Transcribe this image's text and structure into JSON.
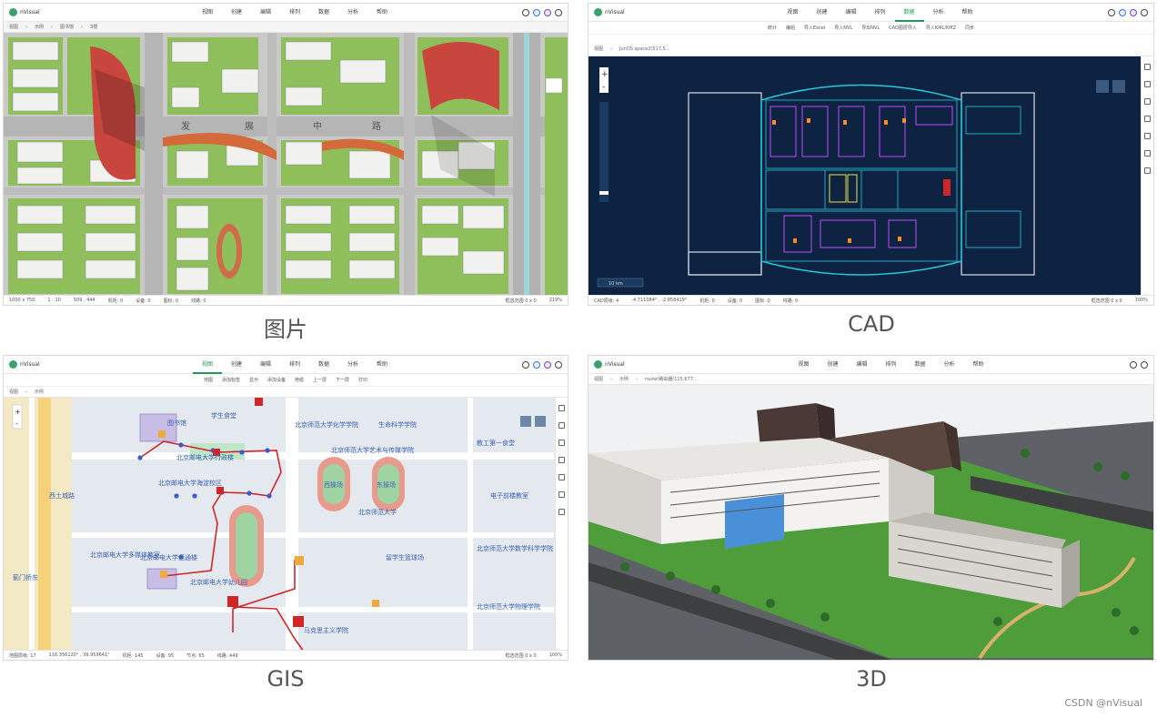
{
  "captions": {
    "image": "图片",
    "cad": "CAD",
    "gis": "GIS",
    "three_d": "3D"
  },
  "app_name": "nVisual",
  "menus": {
    "image": [
      "视图",
      "创建",
      "编辑",
      "排列",
      "数据",
      "分析",
      "帮助"
    ],
    "cad": [
      "视图",
      "创建",
      "编辑",
      "排列",
      "数据",
      "分析",
      "帮助"
    ],
    "gis": [
      "视图",
      "创建",
      "编辑",
      "排列",
      "数据",
      "分析",
      "帮助"
    ],
    "three_d": [
      "视图",
      "创建",
      "编辑",
      "排列",
      "数据",
      "分析",
      "帮助"
    ]
  },
  "active_menu": {
    "cad": "数据",
    "gis": "视图"
  },
  "breadcrumbs": {
    "image": [
      "视图",
      "示例",
      "图书馆",
      "3楼"
    ],
    "cad": [
      "视图",
      "JunOS space2(517,5..."
    ],
    "gis": [
      "视图",
      "示例"
    ],
    "three_d": [
      "视图",
      "示例",
      "router路由器(115,677..."
    ]
  },
  "cad_toolbar": [
    "统计",
    "编组",
    "导入Excel",
    "导入NVL",
    "导出NVL",
    "CAD图层导入",
    "导入KML/KMZ",
    "同步"
  ],
  "gis_toolbar": [
    "地图",
    "添加标签",
    "显示",
    "添加设备",
    "电缆",
    "上一层",
    "下一层",
    "打印"
  ],
  "status": {
    "image": [
      "1000 x 750",
      "1 : 10",
      "509 , 444",
      "机柜: 0",
      "设备: 0",
      "图标: 0",
      "线路: 0",
      "框选范围  0 x 0",
      "219%"
    ],
    "cad": [
      "CAD层级: 4",
      "-4.711084° , -2.858419°",
      "机柜: 0",
      "设备: 0",
      "图标: 0",
      "线路: 0",
      "框选范围  0 x 0",
      "100%"
    ],
    "gis": [
      "地图层级: 17",
      "116.356120° , 39.959641°",
      "机柜: 145",
      "设备: 95",
      "节点: 65",
      "线路: 449",
      "框选范围  0 x 0",
      "100%"
    ]
  },
  "cad_scale": "10 km",
  "gis_labels": [
    "图书馆",
    "北京师范大学化学学院",
    "生命科学学院",
    "北京师范大学艺术与传媒学院",
    "北京邮电大学行政楼",
    "北京邮电大学海淀校区",
    "西操场",
    "东操场",
    "北京邮电大学多媒体教室",
    "北京师范大学",
    "电子前楼教室",
    "北京邮电大学幼儿园",
    "马克思主义学院",
    "学生食堂",
    "教工第一食堂",
    "留学生篮球场",
    "北京师范大学数学科学学院",
    "北京师范大学物理学院",
    "西土城路",
    "蓟门桥东",
    "北京邮电大学运通楼"
  ],
  "watermark": "CSDN @nVisual",
  "colors": {
    "brand": "#1f9a55",
    "cad_bg": "#0e2341",
    "cad_line": "#22c7d8",
    "cad_purple": "#c04bff",
    "route": "#d0262a"
  }
}
